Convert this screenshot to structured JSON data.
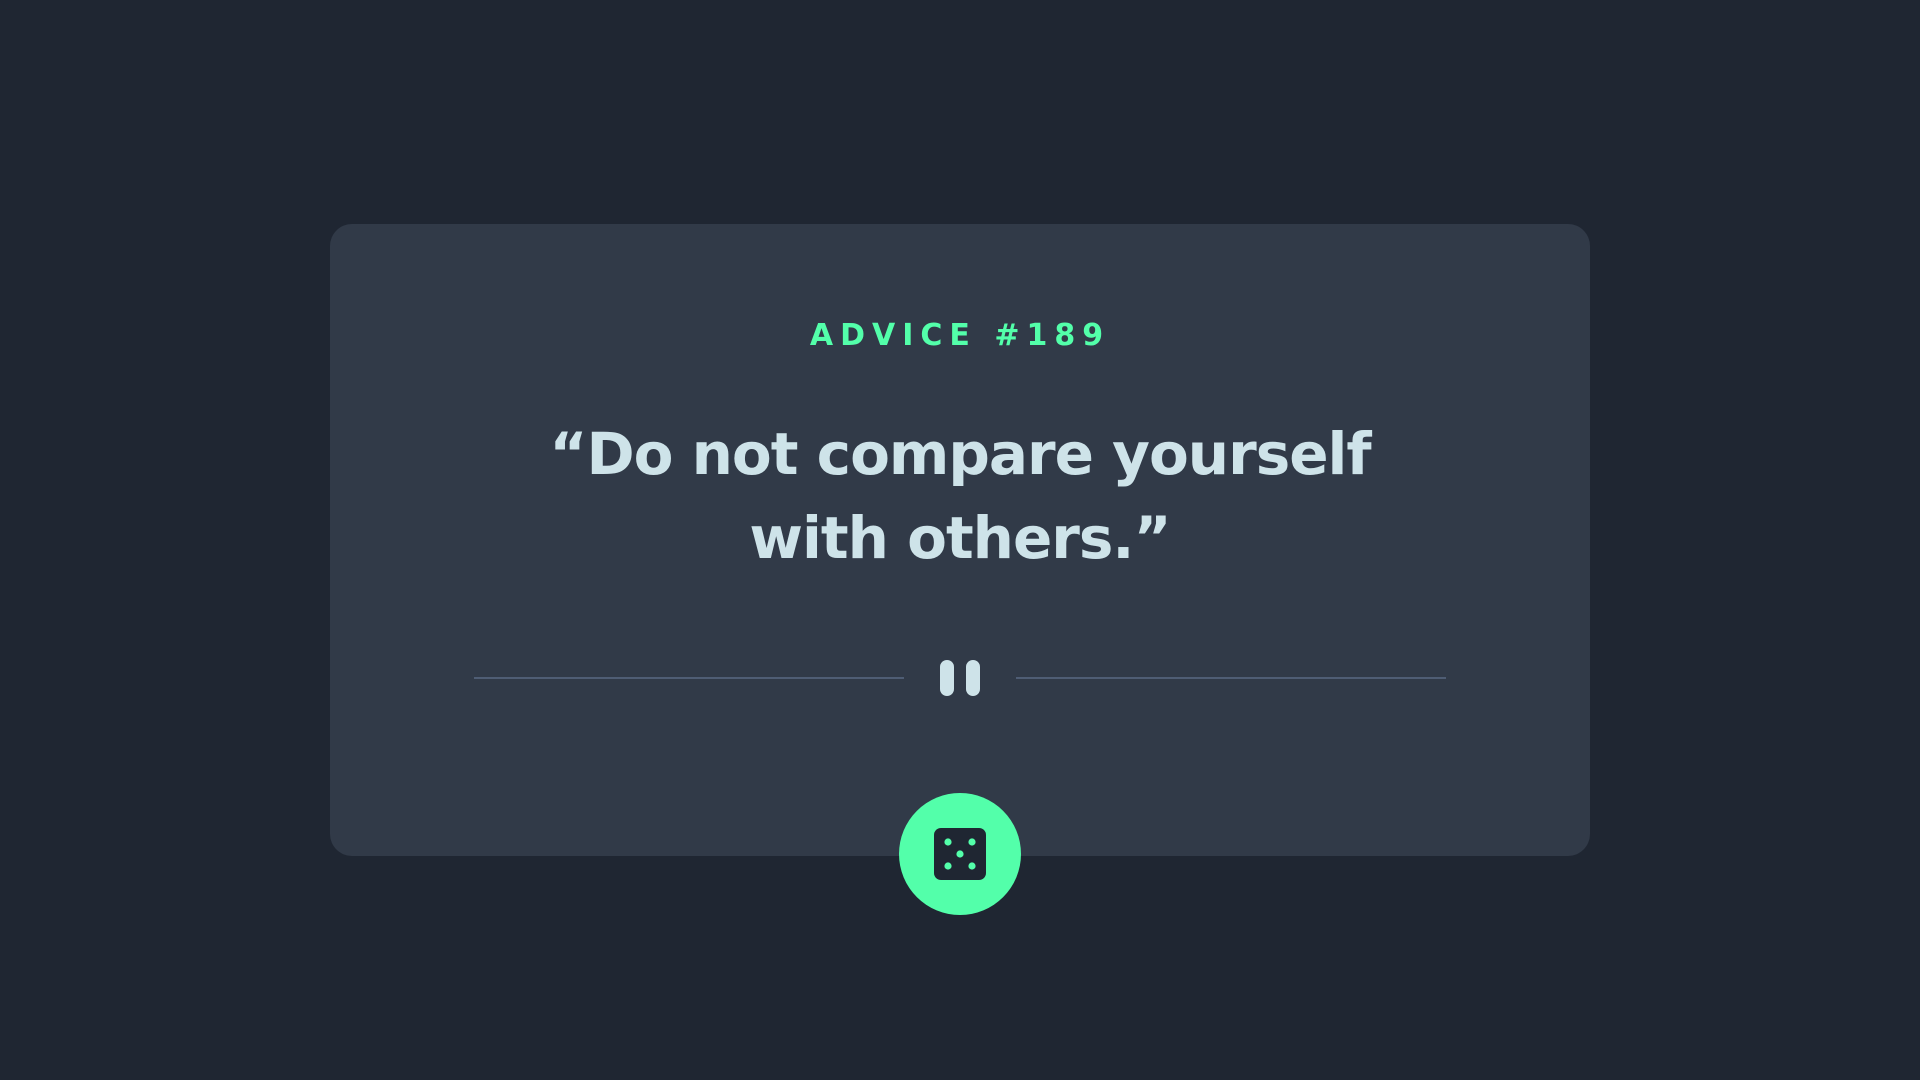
{
  "advice": {
    "id_label": "ADVICE #189",
    "quote": "“Do not compare yourself with others.”"
  },
  "icons": {
    "divider": "pause-icon",
    "button": "dice-icon"
  },
  "colors": {
    "background": "#1f2632",
    "card": "#313a48",
    "accent": "#53ffaa",
    "text": "#cee3e9",
    "divider": "#4f5d74"
  }
}
